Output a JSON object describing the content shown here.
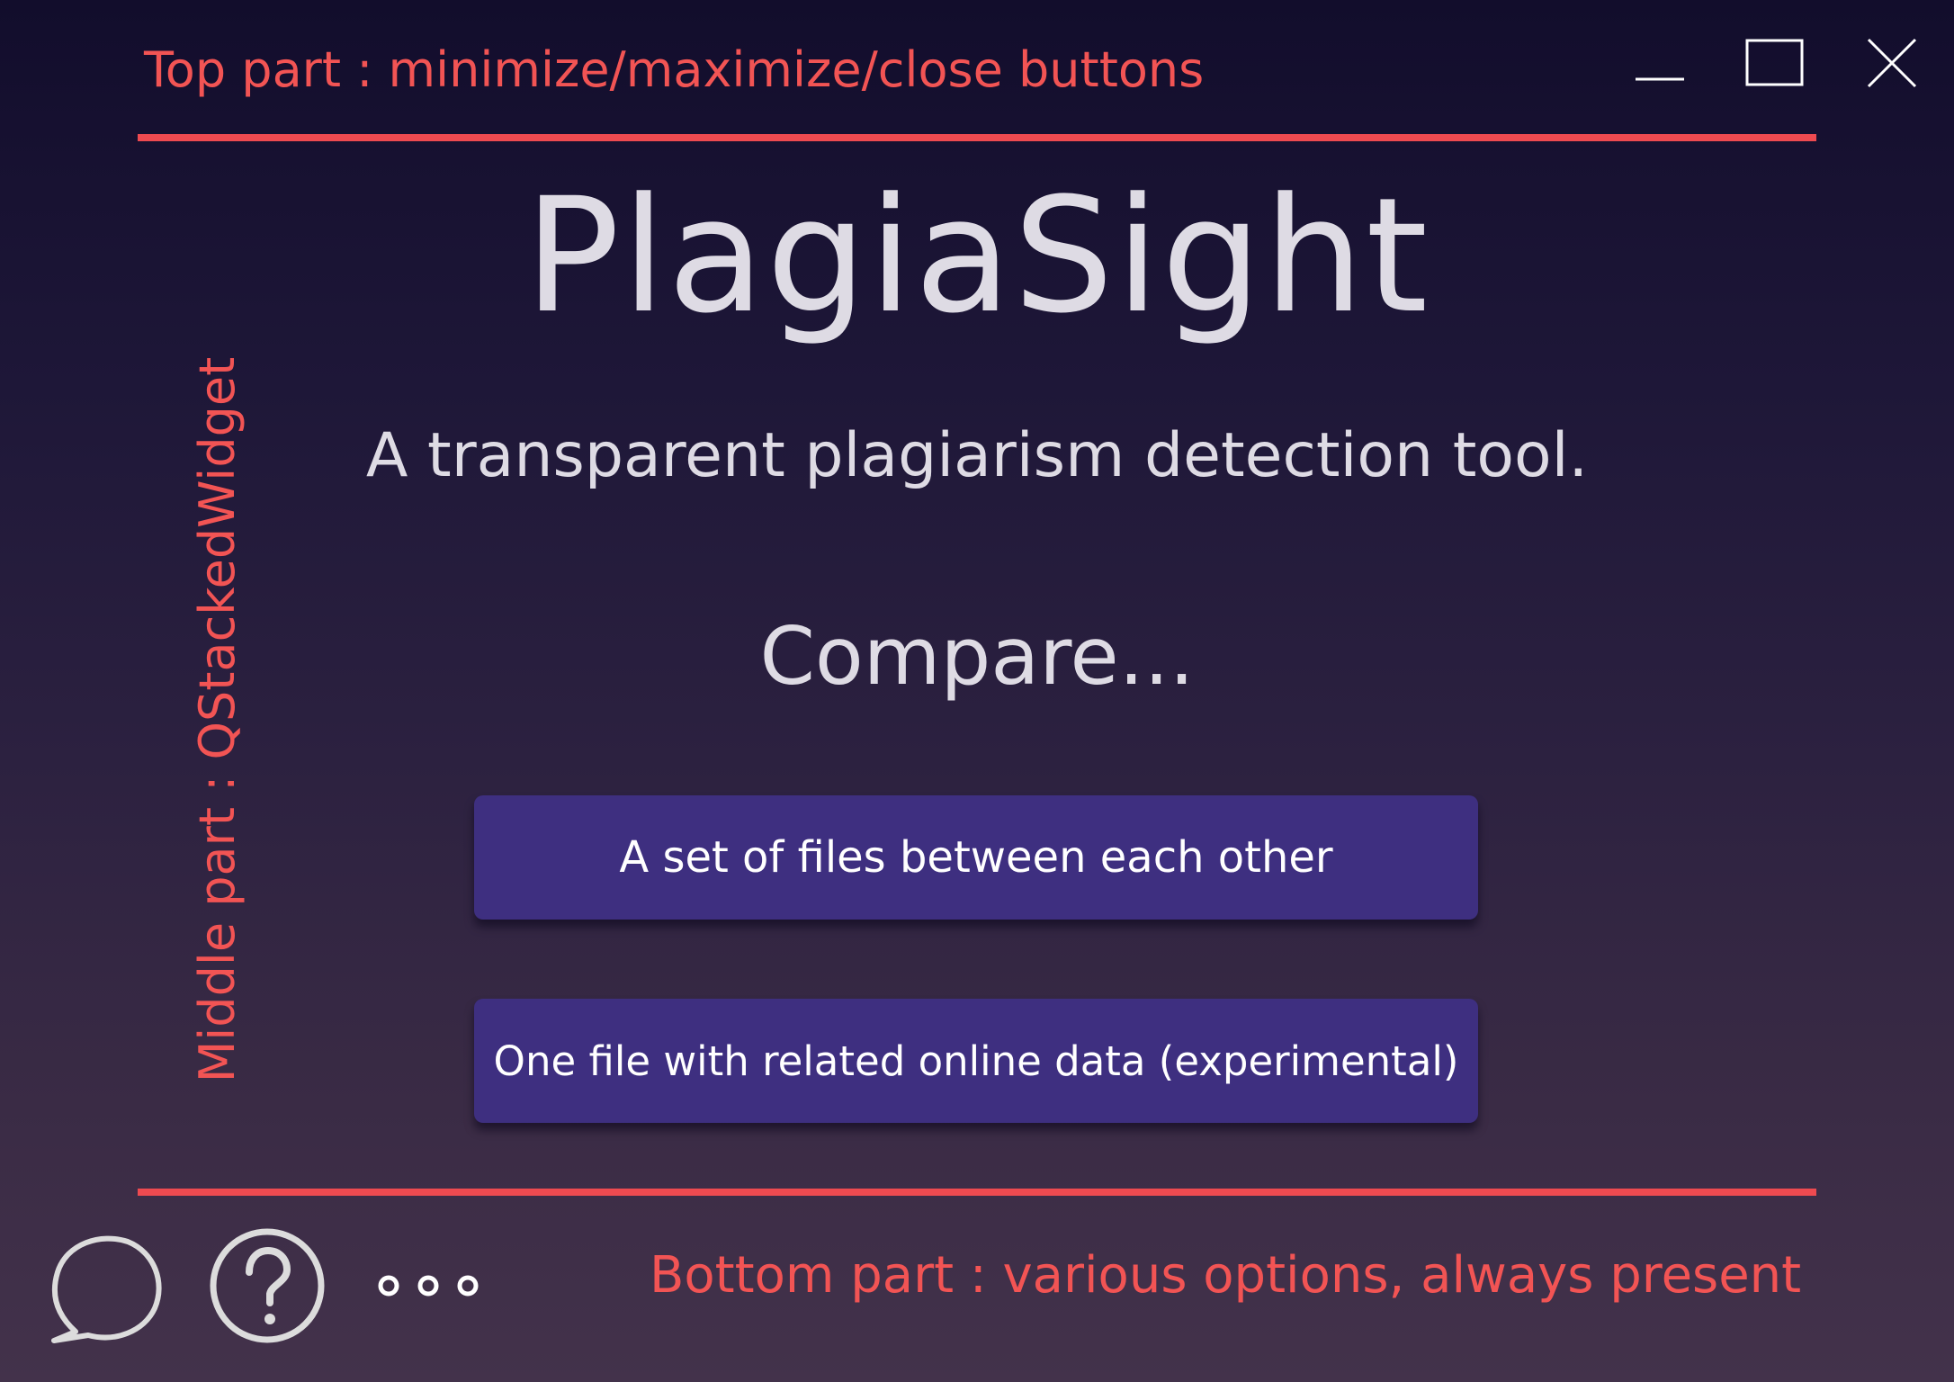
{
  "annotations": {
    "top": "Top part : minimize/maximize/close buttons",
    "middle": "Middle part : QStackedWidget",
    "bottom": "Bottom part : various options, always present"
  },
  "window_controls": {
    "minimize": "minimize-icon",
    "maximize": "maximize-icon",
    "close": "close-icon"
  },
  "main": {
    "title": "PlagiaSight",
    "subtitle": "A transparent plagiarism detection tool.",
    "compare_heading": "Compare...",
    "buttons": [
      {
        "label": "A set of files between each other"
      },
      {
        "label": "One file with related online data (experimental)"
      }
    ]
  },
  "bottom_bar": {
    "icons": [
      "chat-bubble-icon",
      "help-icon",
      "more-options-icon"
    ]
  },
  "colors": {
    "annotation": "#f25454",
    "divider": "#ee4a50",
    "button_bg": "#3e2f80",
    "text": "#dedbe4"
  }
}
